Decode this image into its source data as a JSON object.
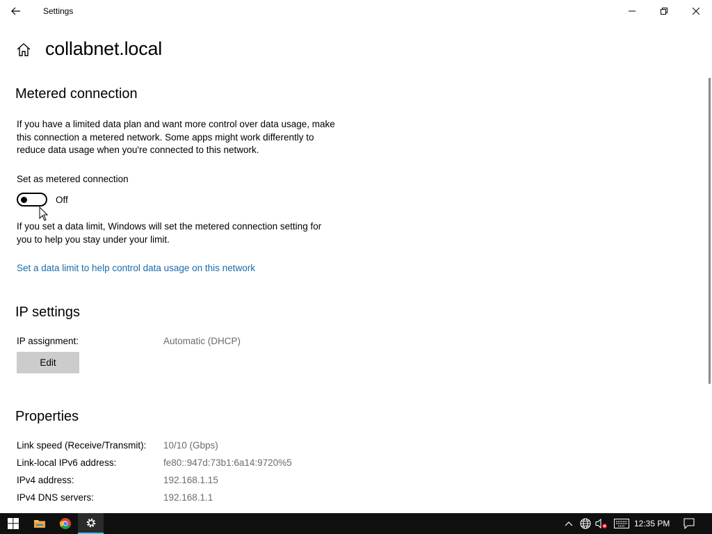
{
  "window": {
    "title": "Settings"
  },
  "header": {
    "page_title": "collabnet.local"
  },
  "metered": {
    "heading": "Metered connection",
    "description": "If you have a limited data plan and want more control over data usage, make this connection a metered network. Some apps might work differently to reduce data usage when you're connected to this network.",
    "toggle_label": "Set as metered connection",
    "toggle_state": "Off",
    "data_limit_text": "If you set a data limit, Windows will set the metered connection setting for you to help you stay under your limit.",
    "data_limit_link": "Set a data limit to help control data usage on this network"
  },
  "ip_settings": {
    "heading": "IP settings",
    "assignment_label": "IP assignment:",
    "assignment_value": "Automatic (DHCP)",
    "edit_label": "Edit"
  },
  "properties": {
    "heading": "Properties",
    "rows": [
      {
        "key": "Link speed (Receive/Transmit):",
        "value": "10/10 (Gbps)"
      },
      {
        "key": "Link-local IPv6 address:",
        "value": "fe80::947d:73b1:6a14:9720%5"
      },
      {
        "key": "IPv4 address:",
        "value": "192.168.1.15"
      },
      {
        "key": "IPv4 DNS servers:",
        "value": "192.168.1.1"
      }
    ]
  },
  "taskbar": {
    "clock": "12:35 PM",
    "apps": [
      "start",
      "file-explorer",
      "chrome",
      "settings"
    ],
    "accent_color": "#4cc2ff"
  },
  "colors": {
    "link": "#1a6aa8",
    "secondary_text": "#6b6b6b",
    "button_bg": "#cccccc",
    "taskbar_bg": "#101010"
  }
}
